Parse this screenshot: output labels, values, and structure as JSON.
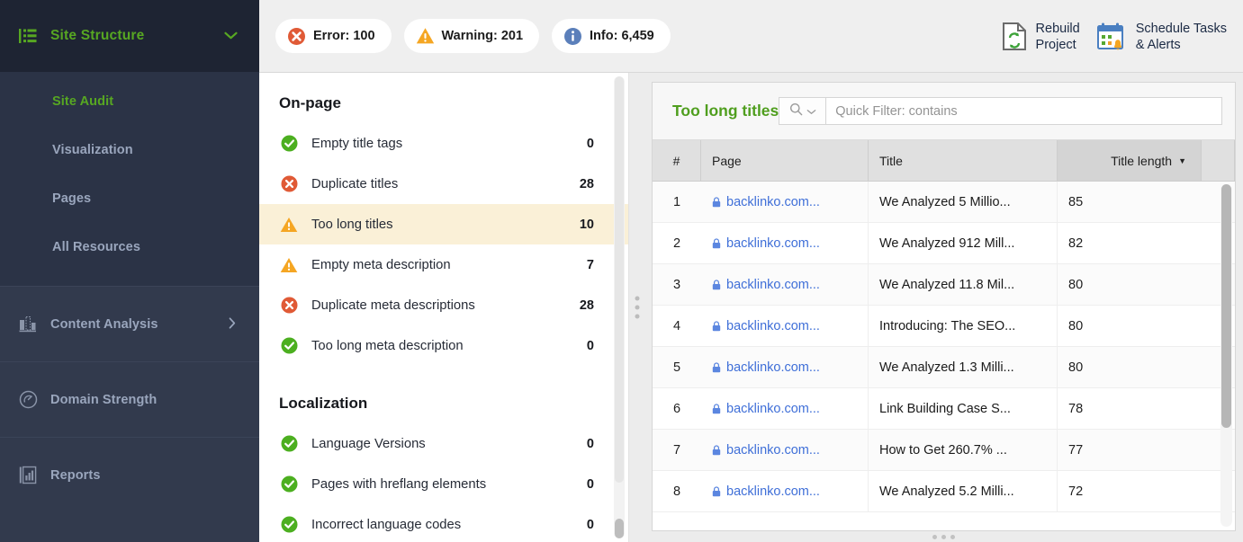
{
  "sidebar": {
    "header": {
      "label": "Site Structure",
      "icon": "site-structure-icon",
      "chevron": "chevron-down-icon"
    },
    "sub_items": [
      {
        "label": "Site Audit",
        "active": true
      },
      {
        "label": "Visualization",
        "active": false
      },
      {
        "label": "Pages",
        "active": false
      },
      {
        "label": "All Resources",
        "active": false
      }
    ],
    "groups": [
      {
        "label": "Content Analysis",
        "icon": "content-analysis-icon",
        "chevron": "chevron-right-icon"
      },
      {
        "label": "Domain Strength",
        "icon": "domain-strength-icon",
        "chevron": ""
      },
      {
        "label": "Reports",
        "icon": "reports-icon",
        "chevron": ""
      }
    ]
  },
  "toolbar": {
    "pills": [
      {
        "label": "Error: 100",
        "icon": "error-icon",
        "color": "#e05a36"
      },
      {
        "label": "Warning: 201",
        "icon": "warning-icon",
        "color": "#f5a623"
      },
      {
        "label": "Info: 6,459",
        "icon": "info-icon",
        "color": "#5b7fba"
      }
    ],
    "actions": [
      {
        "label": "Rebuild\nProject",
        "icon": "rebuild-project-icon"
      },
      {
        "label": "Schedule Tasks\n& Alerts",
        "icon": "schedule-tasks-icon"
      }
    ]
  },
  "checks": {
    "sections": [
      {
        "title": "On-page",
        "items": [
          {
            "label": "Empty title tags",
            "value": "0",
            "status": "ok",
            "selected": false
          },
          {
            "label": "Duplicate titles",
            "value": "28",
            "status": "error",
            "selected": false
          },
          {
            "label": "Too long titles",
            "value": "10",
            "status": "warning",
            "selected": true
          },
          {
            "label": "Empty meta description",
            "value": "7",
            "status": "warning",
            "selected": false
          },
          {
            "label": "Duplicate meta descriptions",
            "value": "28",
            "status": "error",
            "selected": false
          },
          {
            "label": "Too long meta description",
            "value": "0",
            "status": "ok",
            "selected": false
          }
        ]
      },
      {
        "title": "Localization",
        "items": [
          {
            "label": "Language Versions",
            "value": "0",
            "status": "ok",
            "selected": false
          },
          {
            "label": "Pages with hreflang elements",
            "value": "0",
            "status": "ok",
            "selected": false
          },
          {
            "label": "Incorrect language codes",
            "value": "0",
            "status": "ok",
            "selected": false
          }
        ]
      }
    ]
  },
  "table": {
    "title": "Too long titles",
    "quick_filter": {
      "placeholder": "Quick Filter: contains",
      "value": "",
      "icon": "search-icon",
      "dropdown_icon": "chevron-down-icon"
    },
    "columns": [
      {
        "key": "num",
        "label": "#",
        "sorted": false
      },
      {
        "key": "page",
        "label": "Page",
        "sorted": false
      },
      {
        "key": "title",
        "label": "Title",
        "sorted": false
      },
      {
        "key": "length",
        "label": "Title length",
        "sorted": true,
        "sort_dir": "desc"
      }
    ],
    "rows": [
      {
        "num": "1",
        "page": "backlinko.com...",
        "title": "We Analyzed 5 Millio...",
        "length": "85"
      },
      {
        "num": "2",
        "page": "backlinko.com...",
        "title": "We Analyzed 912 Mill...",
        "length": "82"
      },
      {
        "num": "3",
        "page": "backlinko.com...",
        "title": "We Analyzed 11.8 Mil...",
        "length": "80"
      },
      {
        "num": "4",
        "page": "backlinko.com...",
        "title": "Introducing: The SEO...",
        "length": "80"
      },
      {
        "num": "5",
        "page": "backlinko.com...",
        "title": "We Analyzed 1.3 Milli...",
        "length": "80"
      },
      {
        "num": "6",
        "page": "backlinko.com...",
        "title": "Link Building Case S...",
        "length": "78"
      },
      {
        "num": "7",
        "page": "backlinko.com...",
        "title": "How to Get 260.7% ...",
        "length": "77"
      },
      {
        "num": "8",
        "page": "backlinko.com...",
        "title": "We Analyzed 5.2 Milli...",
        "length": "72"
      }
    ]
  },
  "colors": {
    "sidebar_bg": "#323a4d",
    "sidebar_header_bg": "#1e2433",
    "accent_green": "#57a722",
    "title_green": "#4f9e1e",
    "selected_row": "#faf0d7",
    "link_blue": "#3f6fd8",
    "error_red": "#e05a36",
    "warning_orange": "#f5a623",
    "info_blue": "#5b7fba",
    "ok_green": "#4caf20"
  }
}
